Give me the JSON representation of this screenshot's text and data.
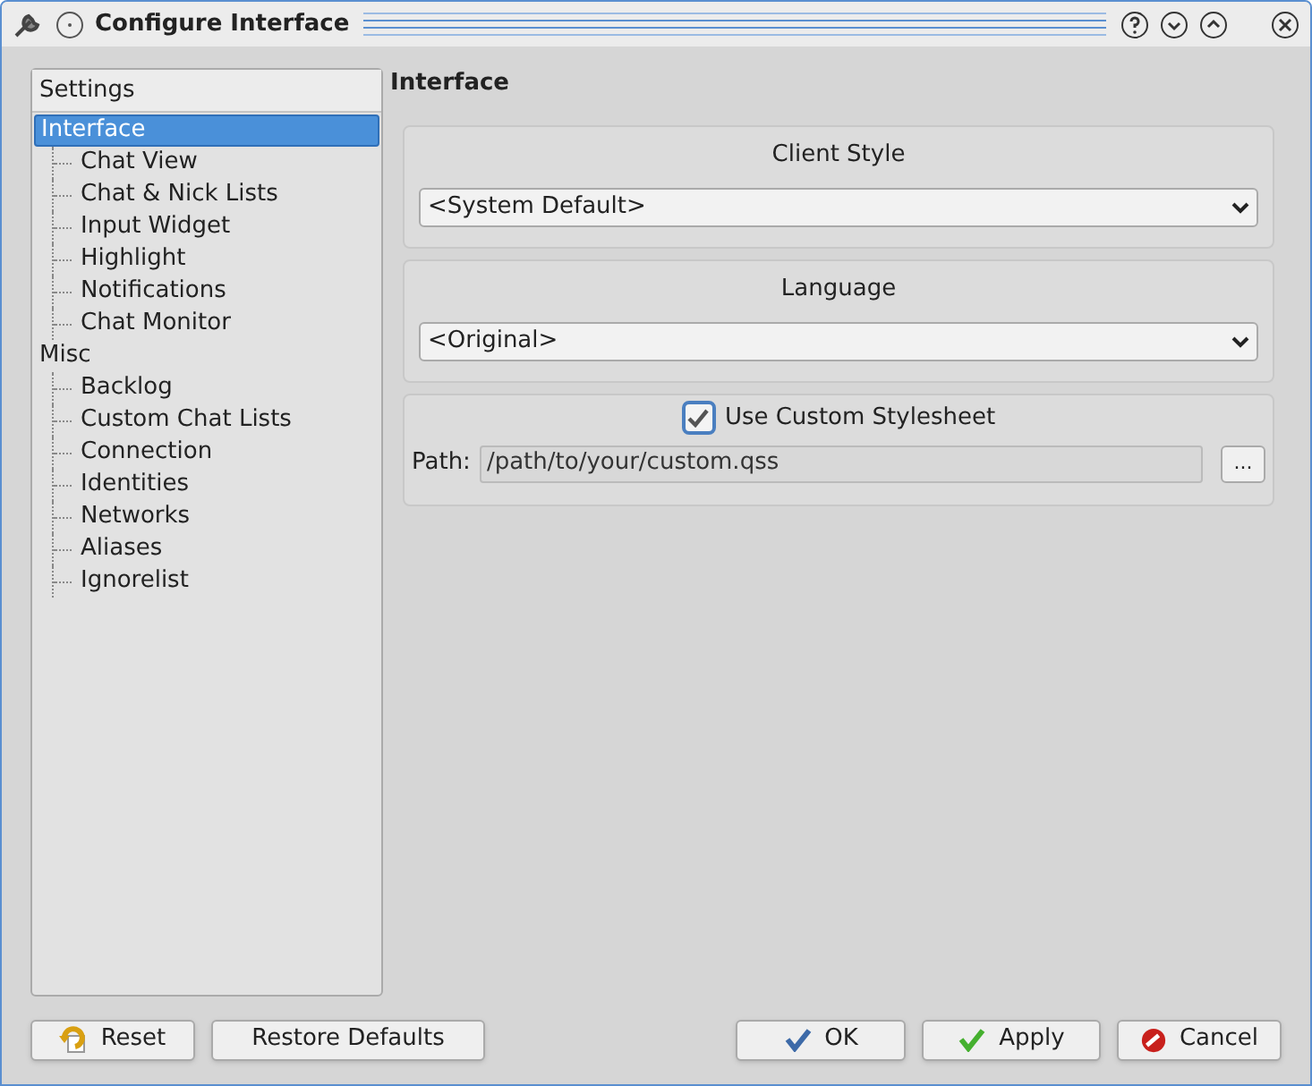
{
  "window": {
    "title": "Configure Interface"
  },
  "sidebar": {
    "header": "Settings",
    "items": [
      {
        "label": "Interface",
        "selected": true,
        "children": [
          {
            "label": "Chat View",
            "selected": false
          },
          {
            "label": "Chat & Nick Lists",
            "selected": false
          },
          {
            "label": "Input Widget",
            "selected": false
          },
          {
            "label": "Highlight",
            "selected": false
          },
          {
            "label": "Notifications",
            "selected": false
          },
          {
            "label": "Chat Monitor",
            "selected": false
          }
        ]
      },
      {
        "label": "Misc",
        "selected": false,
        "children": [
          {
            "label": "Backlog",
            "selected": false
          },
          {
            "label": "Custom Chat Lists",
            "selected": false
          },
          {
            "label": "Connection",
            "selected": false
          },
          {
            "label": "Identities",
            "selected": false
          },
          {
            "label": "Networks",
            "selected": false
          },
          {
            "label": "Aliases",
            "selected": false
          },
          {
            "label": "Ignorelist",
            "selected": false
          }
        ]
      }
    ]
  },
  "page": {
    "title": "Interface",
    "client_style": {
      "label": "Client Style",
      "value": "<System Default>"
    },
    "language": {
      "label": "Language",
      "value": "<Original>"
    },
    "stylesheet": {
      "label": "Use Custom Stylesheet",
      "checked": true,
      "path_label": "Path:",
      "path": "/path/to/your/custom.qss",
      "browse": "..."
    }
  },
  "buttons_left": [
    {
      "label": "Reset",
      "kind": "reset"
    },
    {
      "label": "Restore Defaults",
      "kind": "plain"
    }
  ],
  "buttons_right": [
    {
      "label": "OK",
      "kind": "ok"
    },
    {
      "label": "Apply",
      "kind": "apply"
    },
    {
      "label": "Cancel",
      "kind": "cancel"
    }
  ]
}
